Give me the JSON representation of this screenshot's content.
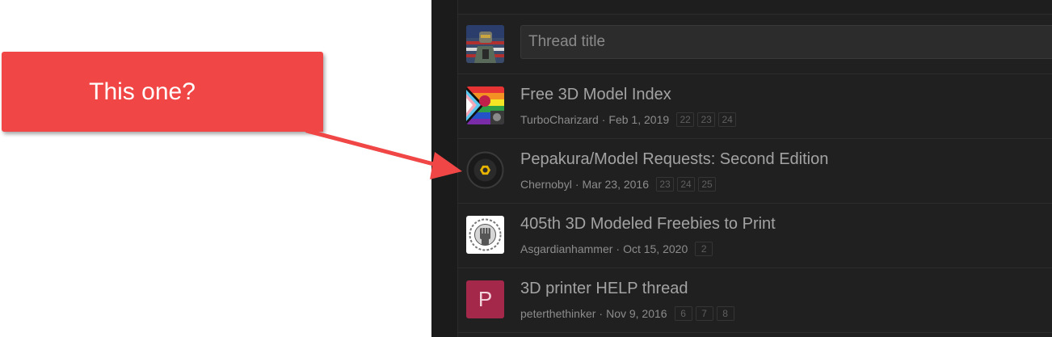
{
  "callout": {
    "text": "This one?",
    "color": "#f14646"
  },
  "new_thread": {
    "placeholder": "Thread title"
  },
  "threads": [
    {
      "title": "Free 3D Model Index",
      "author": "TurboCharizard",
      "date": "Feb 1, 2019",
      "pages": [
        "22",
        "23",
        "24"
      ],
      "avatar": "pride-flag-avatar"
    },
    {
      "title": "Pepakura/Model Requests: Second Edition",
      "author": "Chernobyl",
      "date": "Mar 23, 2016",
      "pages": [
        "23",
        "24",
        "25"
      ],
      "avatar": "hex-nut-avatar"
    },
    {
      "title": "405th 3D Modeled Freebies to Print",
      "author": "Asgardianhammer",
      "date": "Oct 15, 2020",
      "pages": [
        "2"
      ],
      "avatar": "fist-emblem-avatar"
    },
    {
      "title": "3D printer HELP thread",
      "author": "peterthethinker",
      "date": "Nov 9, 2016",
      "pages": [
        "6",
        "7",
        "8"
      ],
      "avatar": "letter-p-avatar",
      "avatar_letter": "P",
      "avatar_color": "#a3284a"
    }
  ],
  "meta_separator": "·"
}
